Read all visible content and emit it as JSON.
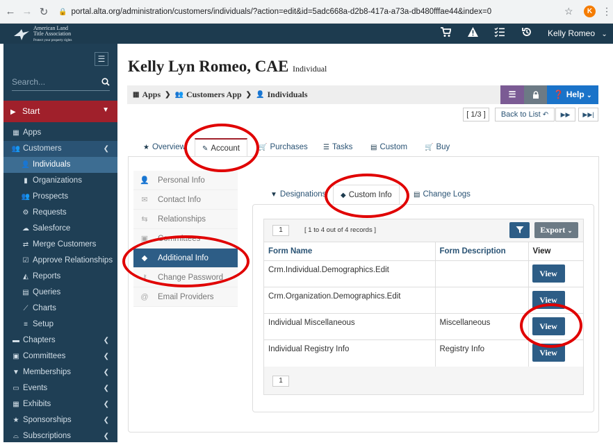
{
  "browser": {
    "url": "portal.alta.org/administration/customers/individuals/?action=edit&id=5adc668a-d2b8-417a-a73a-db480fffae44&index=0",
    "profile_initial": "K"
  },
  "header": {
    "logo_line1": "American Land",
    "logo_line2": "Title Association",
    "logo_tagline": "Protect your property rights",
    "user_name": "Kelly Romeo"
  },
  "sidebar": {
    "search_placeholder": "Search...",
    "start_label": "Start",
    "items": [
      {
        "label": "Apps",
        "icon": "grid-icon"
      },
      {
        "label": "Customers",
        "icon": "users-icon"
      },
      {
        "label": "Individuals",
        "icon": "user-icon"
      },
      {
        "label": "Organizations",
        "icon": "building-icon"
      },
      {
        "label": "Prospects",
        "icon": "users-icon"
      },
      {
        "label": "Requests",
        "icon": "gear-icon"
      },
      {
        "label": "Salesforce",
        "icon": "cloud-icon"
      },
      {
        "label": "Merge Customers",
        "icon": "exchange-icon"
      },
      {
        "label": "Approve Relationships",
        "icon": "check-square-icon"
      },
      {
        "label": "Reports",
        "icon": "area-chart-icon"
      },
      {
        "label": "Queries",
        "icon": "table-icon"
      },
      {
        "label": "Charts",
        "icon": "line-chart-icon"
      },
      {
        "label": "Setup",
        "icon": "list-icon"
      },
      {
        "label": "Chapters",
        "icon": "book-icon"
      },
      {
        "label": "Committees",
        "icon": "briefcase-icon"
      },
      {
        "label": "Memberships",
        "icon": "bookmark-icon"
      },
      {
        "label": "Events",
        "icon": "calendar-icon"
      },
      {
        "label": "Exhibits",
        "icon": "th-icon"
      },
      {
        "label": "Sponsorships",
        "icon": "star-icon"
      },
      {
        "label": "Subscriptions",
        "icon": "inbox-icon"
      }
    ]
  },
  "page": {
    "title": "Kelly Lyn Romeo, CAE",
    "subtitle": "Individual"
  },
  "breadcrumb": {
    "apps": "Apps",
    "customers_app": "Customers App",
    "individuals": "Individuals",
    "help": "Help"
  },
  "pager": {
    "position": "[ 1/3 ]",
    "back_to_list": "Back to List"
  },
  "tabs": {
    "overview": "Overview",
    "account": "Account",
    "purchases": "Purchases",
    "tasks": "Tasks",
    "custom": "Custom",
    "buy": "Buy"
  },
  "account_menu": [
    {
      "label": "Personal Info",
      "icon": "user-icon"
    },
    {
      "label": "Contact Info",
      "icon": "envelope-icon"
    },
    {
      "label": "Relationships",
      "icon": "retweet-icon"
    },
    {
      "label": "Committees",
      "icon": "briefcase-icon"
    },
    {
      "label": "Additional Info",
      "icon": "tags-icon"
    },
    {
      "label": "Change Password",
      "icon": "key-icon"
    },
    {
      "label": "Email Providers",
      "icon": "at-icon"
    }
  ],
  "inner_tabs": {
    "designations": "Designations",
    "custom_info": "Custom Info",
    "change_logs": "Change Logs"
  },
  "grid": {
    "page": "1",
    "records_text": "[ 1 to 4 out of 4 records ]",
    "export_label": "Export",
    "columns": [
      "Form Name",
      "Form Description",
      "View"
    ],
    "rows": [
      {
        "name": "Crm.Individual.Demographics.Edit",
        "description": "",
        "view": "View"
      },
      {
        "name": "Crm.Organization.Demographics.Edit",
        "description": "",
        "view": "View"
      },
      {
        "name": "Individual Miscellaneous",
        "description": "Miscellaneous",
        "view": "View"
      },
      {
        "name": "Individual Registry Info",
        "description": "Registry Info",
        "view": "View"
      }
    ],
    "footer_page": "1"
  },
  "colors": {
    "header_bg": "#1d3b4f",
    "sidebar_bg": "#1f3f55",
    "start_red": "#a0202b",
    "primary_blue": "#2d5d86",
    "help_blue": "#1a73c9",
    "purple": "#7b5b94",
    "annotation_red": "#e00000"
  }
}
